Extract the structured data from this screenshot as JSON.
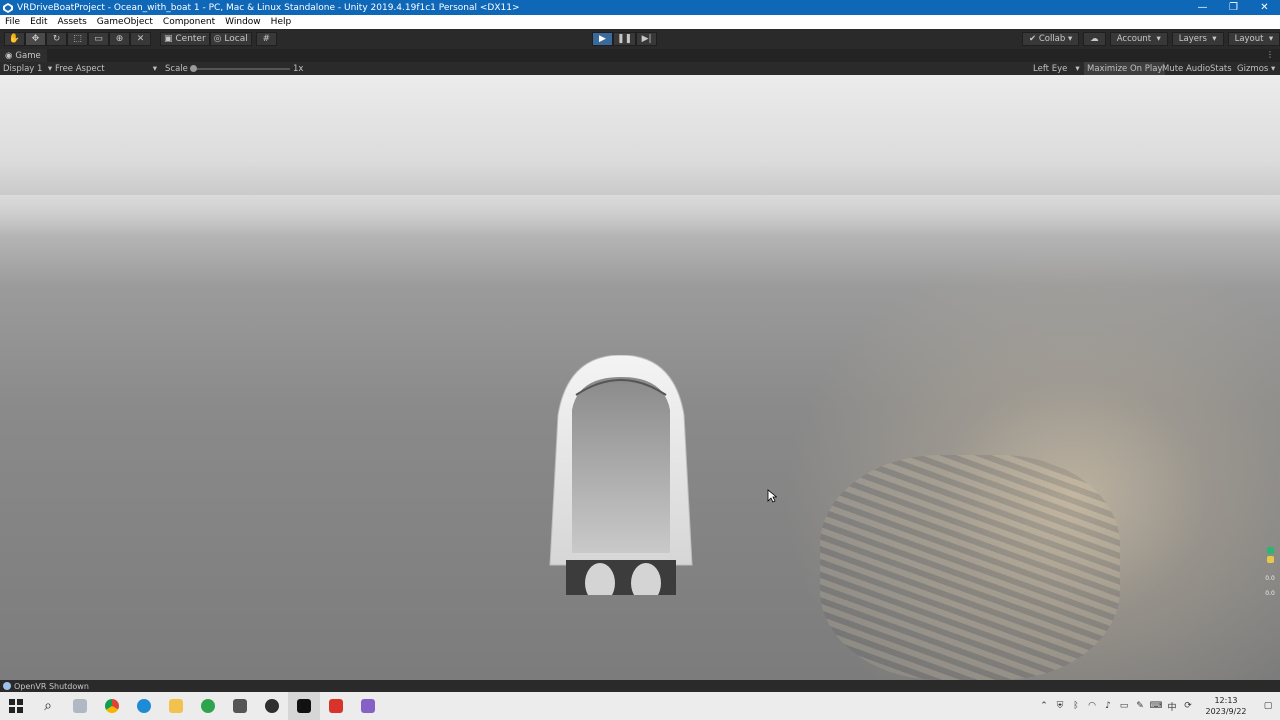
{
  "window": {
    "title": "VRDriveBoatProject - Ocean_with_boat 1 - PC, Mac & Linux Standalone - Unity 2019.4.19f1c1 Personal <DX11>",
    "controls": [
      "—",
      "❐",
      "✕"
    ]
  },
  "menu": [
    "File",
    "Edit",
    "Assets",
    "GameObject",
    "Component",
    "Window",
    "Help"
  ],
  "toolbar": {
    "tools": [
      "hand-tool",
      "move-tool",
      "rotate-tool",
      "scale-tool",
      "rect-tool",
      "transform-tool",
      "custom-tool"
    ],
    "pivot_label": "Center",
    "space_label": "Local",
    "play_active": true,
    "collab_label": "Collab",
    "account_label": "Account",
    "layers_label": "Layers",
    "layout_label": "Layout"
  },
  "tab": {
    "label": "Game"
  },
  "game_bar": {
    "display": "Display 1",
    "aspect": "Free Aspect",
    "scale_label": "Scale",
    "scale_value_text": "1x",
    "scale_value": 1,
    "eye": "Left Eye",
    "maximize_on_play": "Maximize On Play",
    "mute_audio": "Mute Audio",
    "stats": "Stats",
    "gizmos": "Gizmos"
  },
  "gizmo_readout": [
    "0.0",
    "0.0"
  ],
  "status": {
    "message": "OpenVR Shutdown"
  },
  "taskbar": {
    "apps": [
      "start",
      "search",
      "file-explorer",
      "chrome",
      "edge",
      "folder",
      "app",
      "unity-hub",
      "obs",
      "unity",
      "wps",
      "visual-studio"
    ],
    "time": "12:13",
    "date": "2023/9/22"
  },
  "colors": {
    "titlebar": "#0f67b8",
    "editor_bg": "#2a2a2a",
    "play_accent": "#3a6a9c"
  }
}
